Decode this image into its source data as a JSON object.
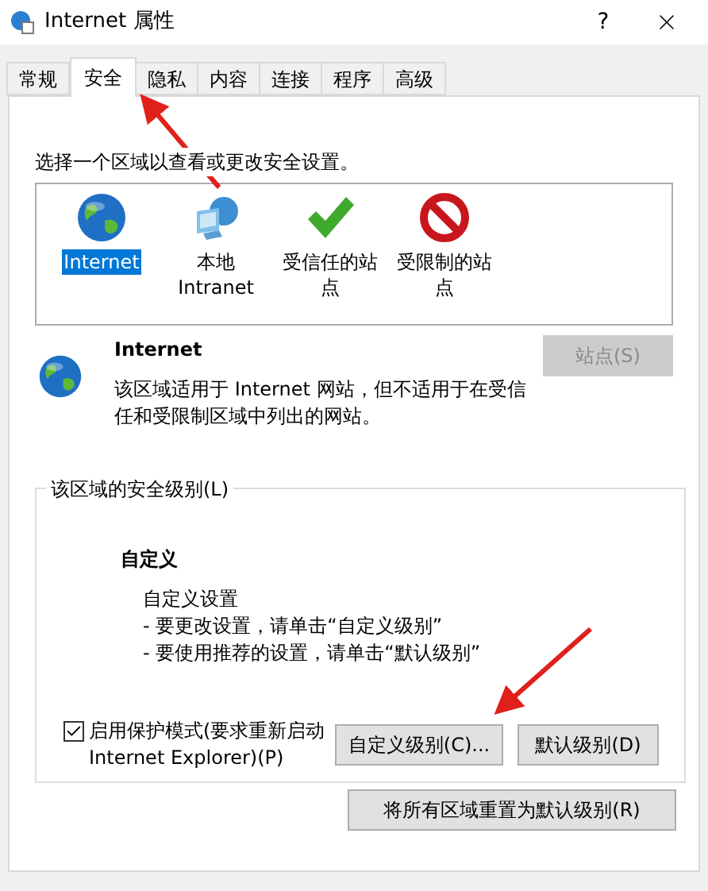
{
  "window": {
    "title": "Internet 属性",
    "help": "?"
  },
  "tabs": [
    {
      "label": "常规",
      "selected": false
    },
    {
      "label": "安全",
      "selected": true
    },
    {
      "label": "隐私",
      "selected": false
    },
    {
      "label": "内容",
      "selected": false
    },
    {
      "label": "连接",
      "selected": false
    },
    {
      "label": "程序",
      "selected": false
    },
    {
      "label": "高级",
      "selected": false
    }
  ],
  "zone_prompt": "选择一个区域以查看或更改安全设置。",
  "zones": [
    {
      "kind": "internet",
      "label": "Internet",
      "selected": true
    },
    {
      "kind": "intranet",
      "label": "本地 Intranet",
      "selected": false
    },
    {
      "kind": "trusted",
      "label": "受信任的站点",
      "selected": false
    },
    {
      "kind": "restricted",
      "label": "受限制的站点",
      "selected": false
    }
  ],
  "zone_info": {
    "kind": "internet",
    "title": "Internet",
    "description": "该区域适用于 Internet 网站，但不适用于在受信任和受限制区域中列出的网站。",
    "sites_button": {
      "label": "站点(S)",
      "disabled": true
    }
  },
  "security_level": {
    "legend": "该区域的安全级别(L)",
    "level_name": "自定义",
    "heading": "自定义设置",
    "hints": [
      "- 要更改设置，请单击“自定义级别”",
      "- 要使用推荐的设置，请单击“默认级别”"
    ],
    "protected_mode": {
      "label": "启用保护模式(要求重新启动 Internet Explorer)(P)",
      "checked": true
    },
    "buttons": [
      "自定义级别(C)...",
      "默认级别(D)"
    ]
  },
  "reset_button": "将所有区域重置为默认级别(R)"
}
